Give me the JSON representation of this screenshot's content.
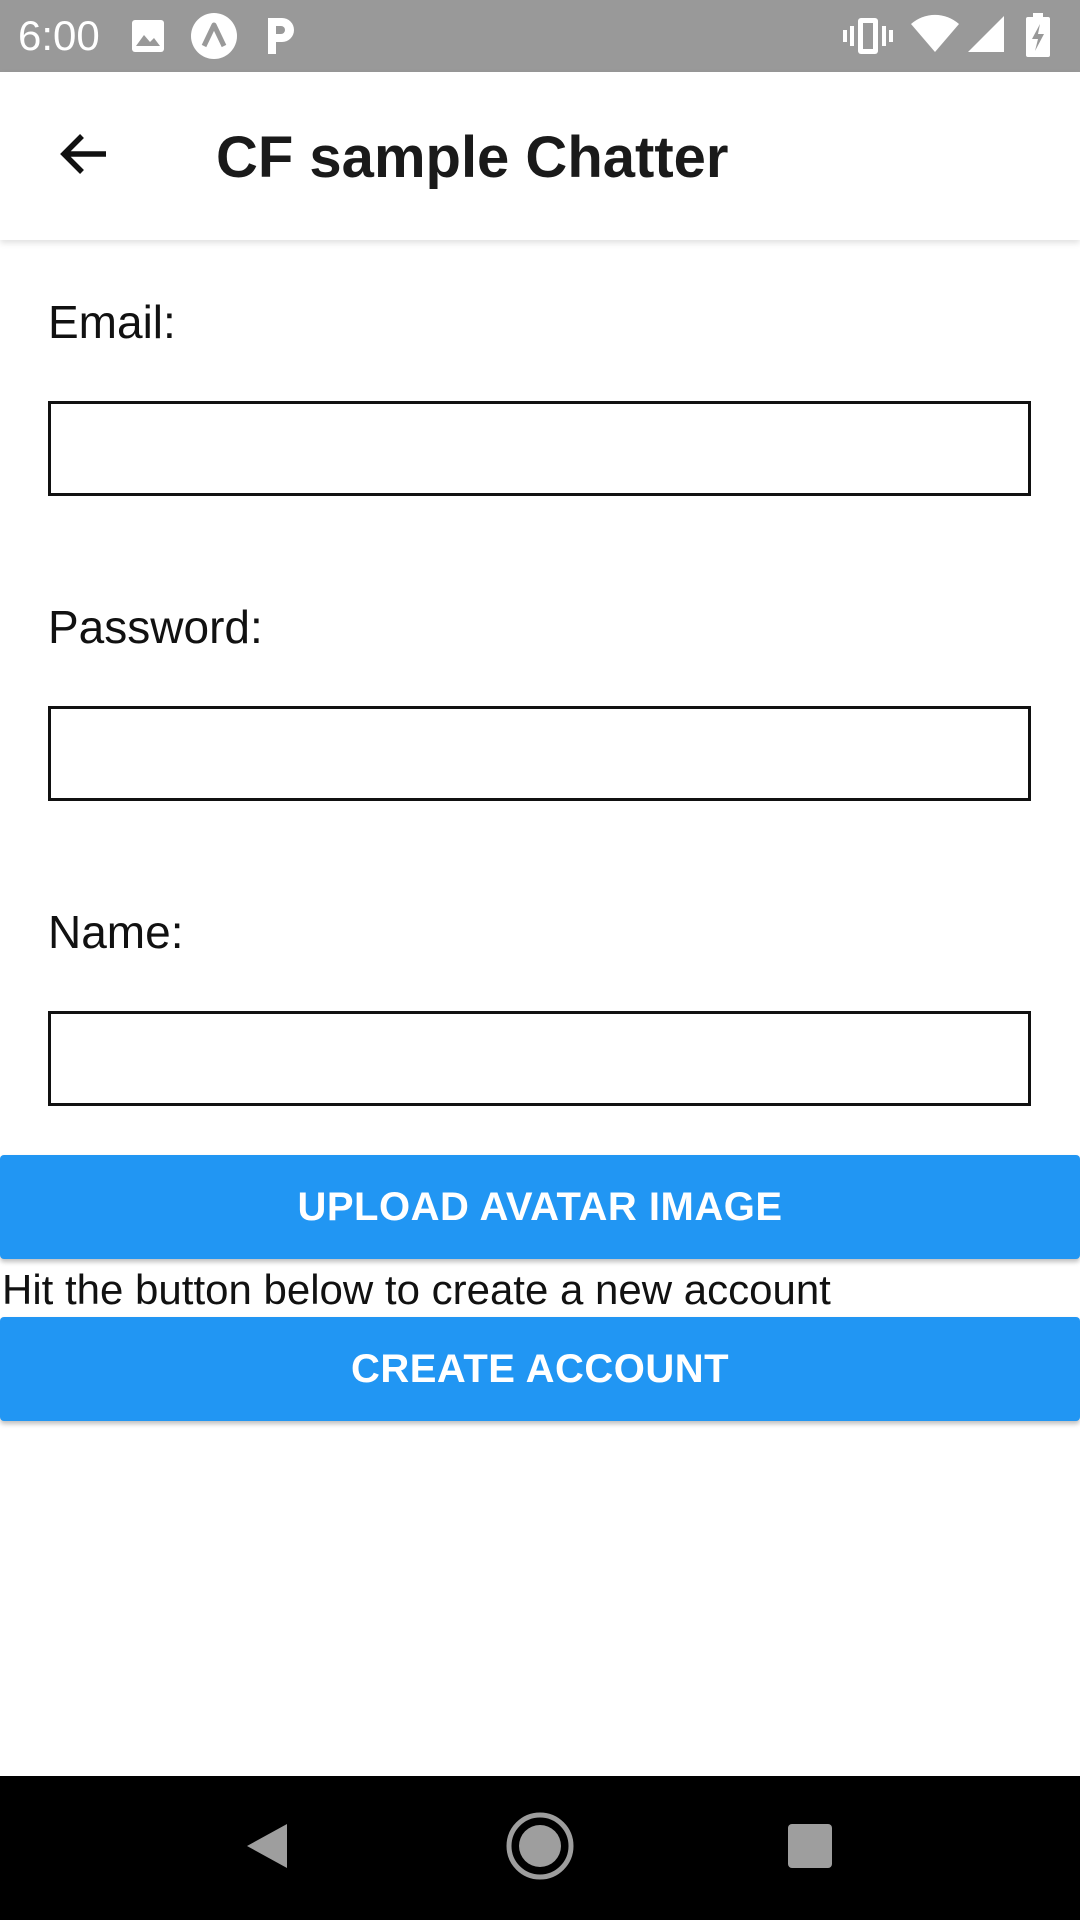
{
  "status_bar": {
    "time": "6:00",
    "icons": [
      "image-icon",
      "arrow-app-icon",
      "parking-icon",
      "vibrate-icon",
      "wifi-icon",
      "signal-icon",
      "battery-charging-icon"
    ]
  },
  "app_bar": {
    "title": "CF sample Chatter",
    "back_icon": "arrow-back-icon"
  },
  "form": {
    "email_label": "Email:",
    "email_value": "",
    "password_label": "Password:",
    "password_value": "",
    "name_label": "Name:",
    "name_value": ""
  },
  "upload_button_label": "UPLOAD AVATAR IMAGE",
  "hint": "Hit the button below to create a new account",
  "create_button_label": "CREATE ACCOUNT",
  "nav_bar": {
    "icons": [
      "nav-back-icon",
      "nav-home-icon",
      "nav-recents-icon"
    ]
  },
  "colors": {
    "status_bar": "#999999",
    "accent": "#2196F3",
    "nav_bar": "#000000"
  }
}
